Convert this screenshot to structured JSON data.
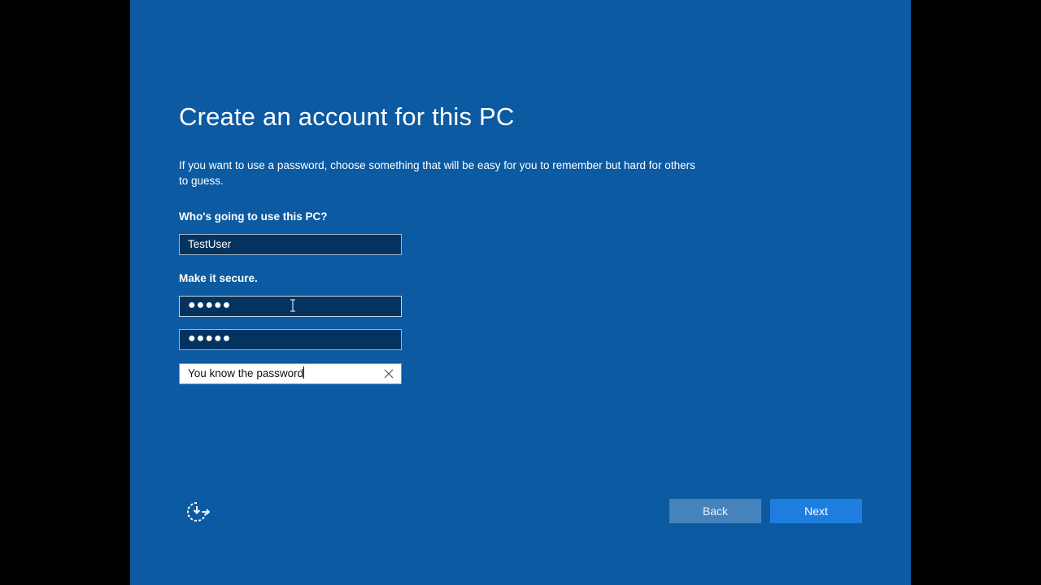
{
  "page": {
    "title": "Create an account for this PC",
    "description": "If you want to use a password, choose something that will be easy for you to remember but hard for others to guess."
  },
  "user_section": {
    "label": "Who's going to use this PC?",
    "username_value": "TestUser"
  },
  "secure_section": {
    "label": "Make it secure.",
    "password_masked": "●●●●●",
    "confirm_password_masked": "●●●●●",
    "hint_value": "You know the password"
  },
  "footer": {
    "back_label": "Back",
    "next_label": "Next",
    "accessibility_icon": "ease-of-access-icon"
  },
  "colors": {
    "background": "#0b5aa2",
    "field_background": "#05335f",
    "next_button": "#1e7ee0",
    "back_button": "#4683bd"
  }
}
